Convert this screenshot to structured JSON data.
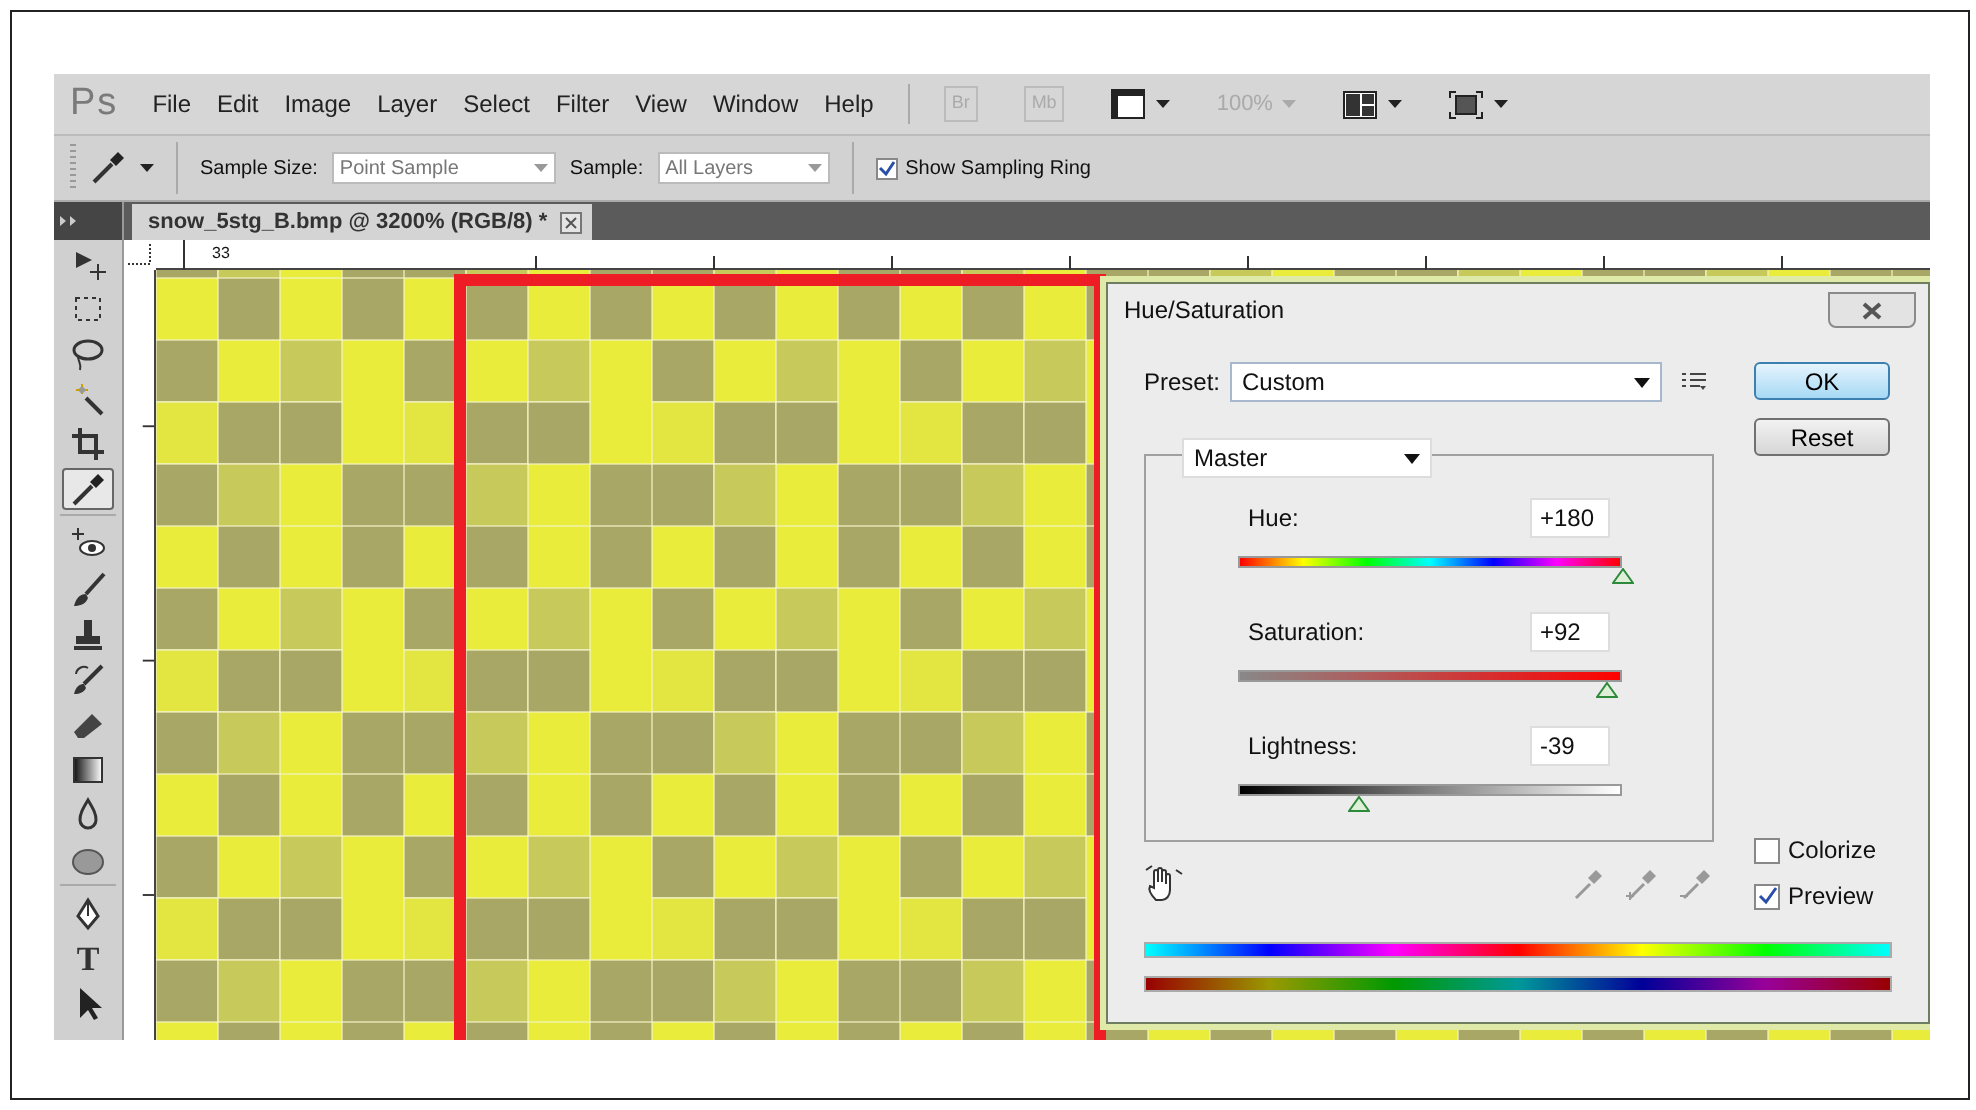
{
  "app": {
    "logo": "Ps",
    "menu": [
      "File",
      "Edit",
      "Image",
      "Layer",
      "Select",
      "Filter",
      "View",
      "Window",
      "Help"
    ],
    "top_icons": [
      {
        "kind": "bridge",
        "label": "Br",
        "disabled": true
      },
      {
        "kind": "minibridge",
        "label": "Mb",
        "disabled": true
      },
      {
        "kind": "extras",
        "disabled": false
      },
      {
        "kind": "zoom",
        "label": "100%",
        "disabled": true
      },
      {
        "kind": "arrange",
        "disabled": false
      },
      {
        "kind": "screen-mode",
        "disabled": false
      }
    ]
  },
  "options_bar": {
    "sample_size": {
      "label": "Sample Size:",
      "value": "Point Sample"
    },
    "sample": {
      "label": "Sample:",
      "value": "All Layers"
    },
    "show_sampling_ring": {
      "label": "Show Sampling Ring",
      "checked": true
    }
  },
  "document_tab": {
    "title": "snow_5stg_B.bmp @ 3200% (RGB/8) *"
  },
  "ruler": {
    "label": "33"
  },
  "tools": [
    {
      "kind": "move",
      "selected": false
    },
    {
      "kind": "marquee",
      "selected": false
    },
    {
      "kind": "lasso",
      "selected": false
    },
    {
      "kind": "magic-wand",
      "selected": false
    },
    {
      "kind": "crop",
      "selected": false
    },
    {
      "kind": "eyedropper",
      "selected": true
    },
    {
      "kind": "red-eye",
      "group_start": true,
      "selected": false
    },
    {
      "kind": "brush",
      "selected": false
    },
    {
      "kind": "stamp",
      "selected": false
    },
    {
      "kind": "history-brush",
      "selected": false
    },
    {
      "kind": "eraser",
      "selected": false
    },
    {
      "kind": "gradient",
      "selected": false
    },
    {
      "kind": "drop",
      "selected": false
    },
    {
      "kind": "sponge",
      "selected": false
    },
    {
      "kind": "pen",
      "group_start": true,
      "selected": false
    },
    {
      "kind": "type",
      "glyph": "T",
      "selected": false
    },
    {
      "kind": "path-select",
      "selected": false
    }
  ],
  "dialog": {
    "title": "Hue/Saturation",
    "preset": {
      "label": "Preset:",
      "value": "Custom"
    },
    "channel": "Master",
    "sliders": [
      {
        "kind": "hue",
        "label": "Hue:",
        "value": "+180",
        "level": 1.0
      },
      {
        "kind": "saturation",
        "label": "Saturation:",
        "value": "+92",
        "level": 0.96
      },
      {
        "kind": "lightness",
        "label": "Lightness:",
        "value": "-39",
        "level": 0.31
      }
    ],
    "buttons": [
      {
        "label": "OK",
        "default": true
      },
      {
        "label": "Reset",
        "default": false
      }
    ],
    "checkboxes": [
      {
        "label": "Colorize",
        "checked": false
      },
      {
        "label": "Preview",
        "checked": true
      }
    ]
  }
}
